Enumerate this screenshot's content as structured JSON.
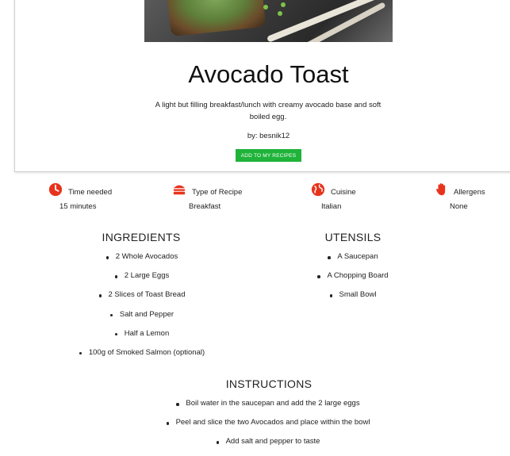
{
  "recipe": {
    "title": "Avocado Toast",
    "description": "A light but filling breakfast/lunch with creamy avocado base and soft boiled egg.",
    "author": "by: besnik12",
    "add_button": "ADD TO MY RECIPES"
  },
  "meta": {
    "time": {
      "label": "Time needed",
      "value": "15 minutes",
      "icon": "clock-icon"
    },
    "type": {
      "label": "Type of Recipe",
      "value": "Breakfast",
      "icon": "burger-icon"
    },
    "cuisine": {
      "label": "Cuisine",
      "value": "Italian",
      "icon": "globe-icon"
    },
    "allergens": {
      "label": "Allergens",
      "value": "None",
      "icon": "hand-icon"
    }
  },
  "ingredients": {
    "heading": "INGREDIENTS",
    "items": [
      "2 Whole Avocados",
      "2 Large Eggs",
      "2 Slices of Toast Bread",
      "Salt and Pepper",
      "Half a Lemon",
      "100g of Smoked Salmon (optional)"
    ]
  },
  "utensils": {
    "heading": "UTENSILS",
    "items": [
      "A Saucepan",
      "A Chopping Board",
      "Small Bowl"
    ]
  },
  "instructions": {
    "heading": "INSTRUCTIONS",
    "items": [
      "Boil water in the saucepan and add the 2 large eggs",
      "Peel and slice the two Avocados and place within the bowl",
      "Add salt and pepper to taste"
    ]
  },
  "colors": {
    "accent": "#e8331c",
    "button": "#1fb33a"
  }
}
